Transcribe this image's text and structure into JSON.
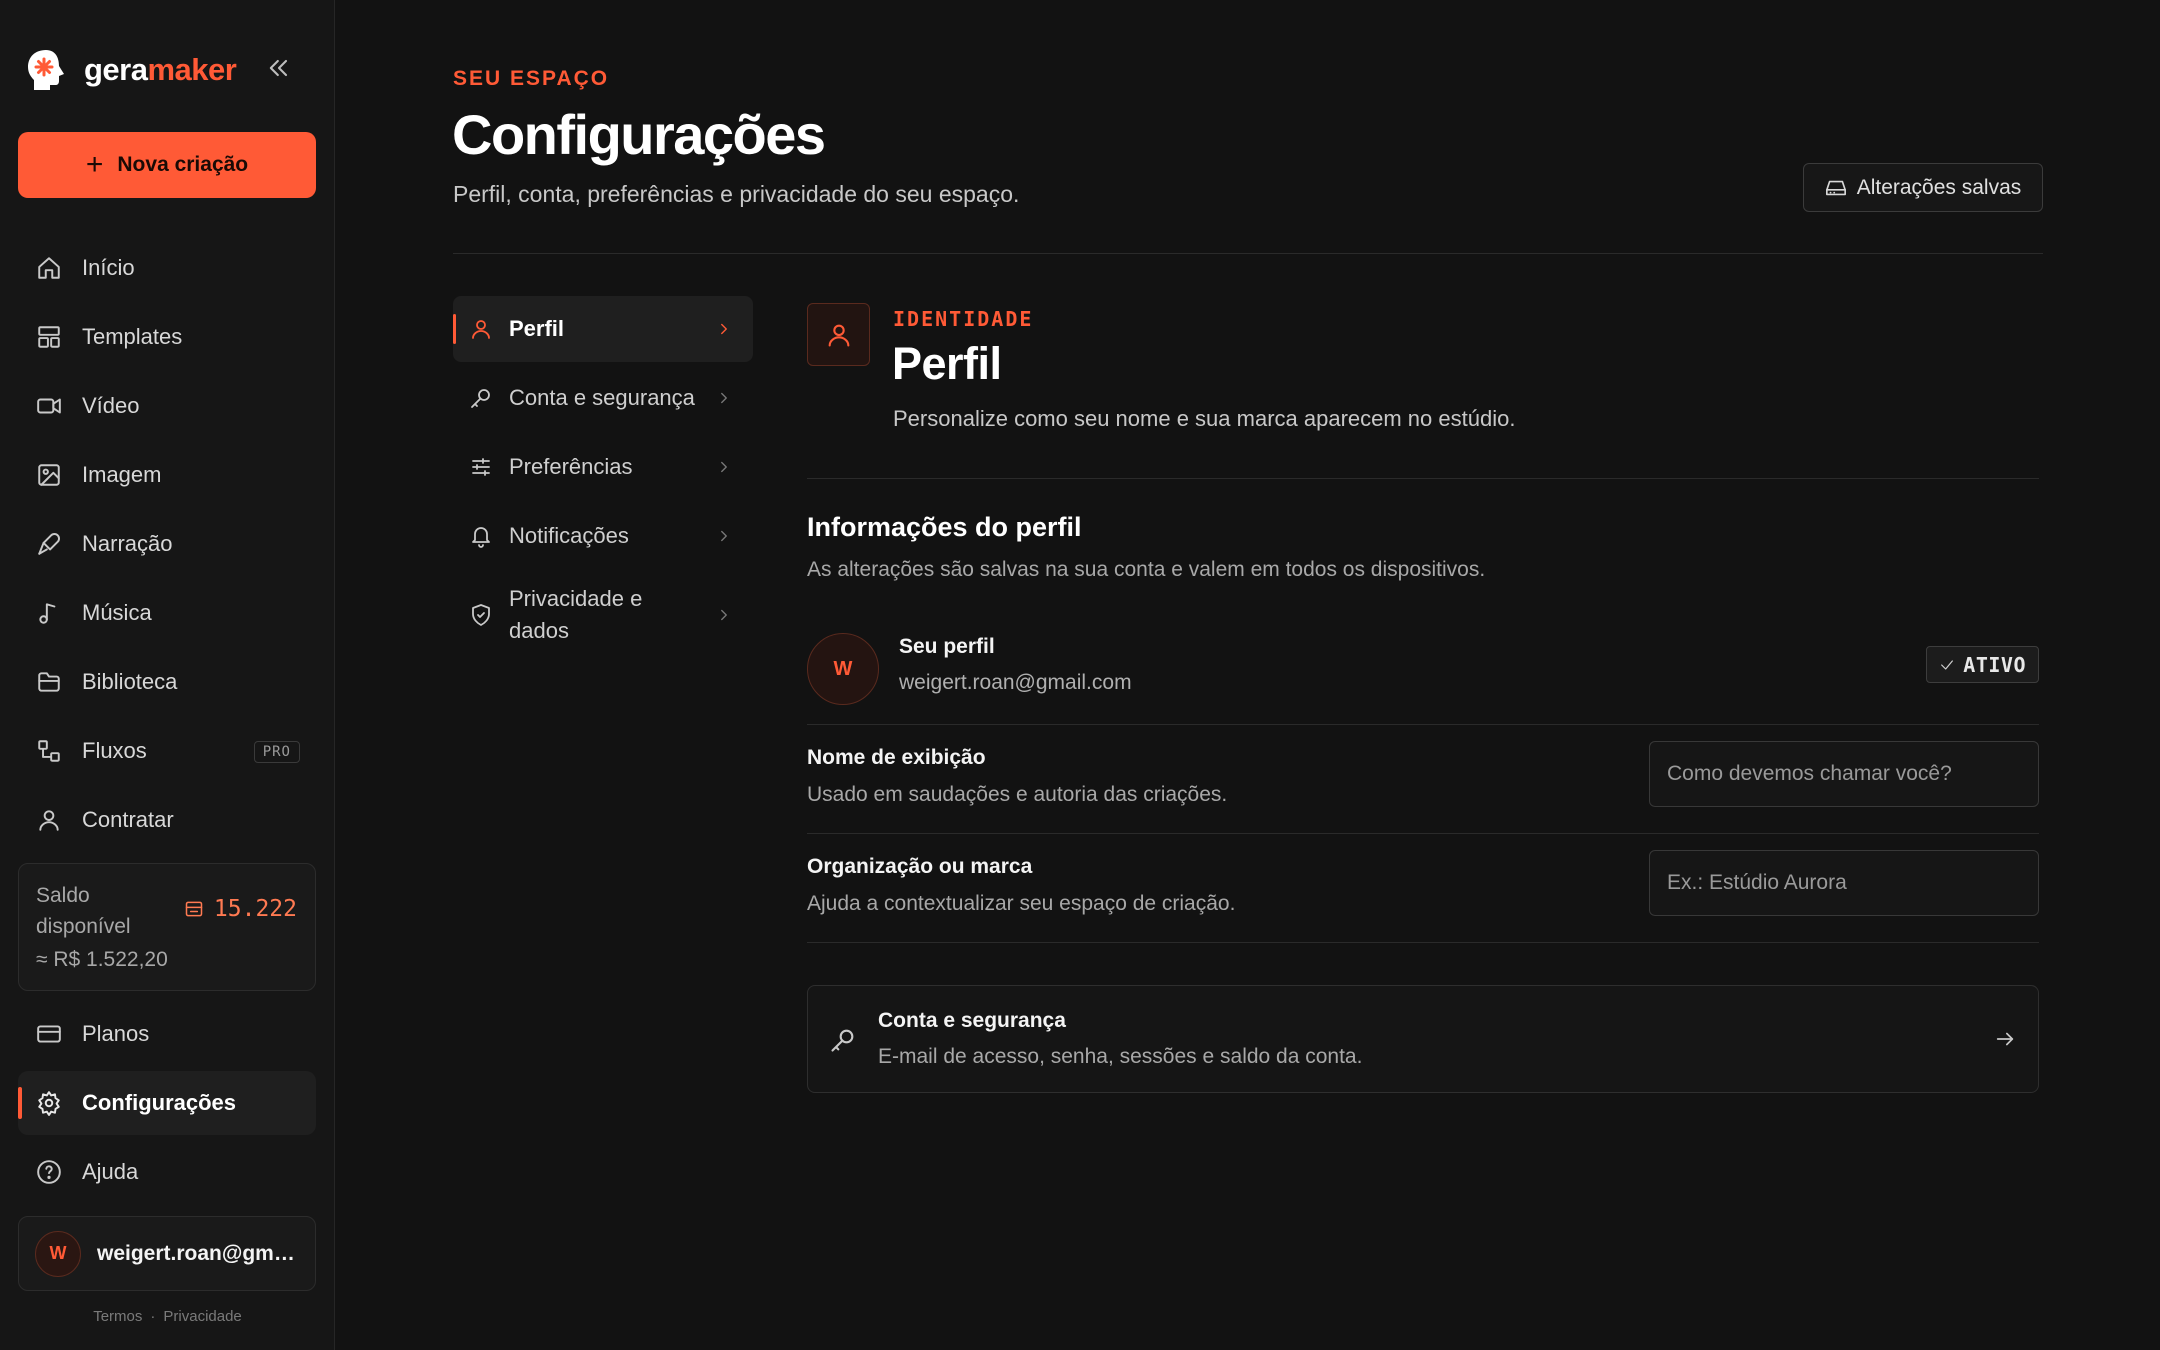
{
  "brand": {
    "name_part1": "gera",
    "name_part2": "maker"
  },
  "sidebar": {
    "new_button": "Nova criação",
    "items": [
      {
        "label": "Início",
        "icon": "home-icon"
      },
      {
        "label": "Templates",
        "icon": "layout-icon"
      },
      {
        "label": "Vídeo",
        "icon": "video-icon"
      },
      {
        "label": "Imagem",
        "icon": "image-icon"
      },
      {
        "label": "Narração",
        "icon": "microphone-icon"
      },
      {
        "label": "Música",
        "icon": "music-note-icon"
      },
      {
        "label": "Biblioteca",
        "icon": "folder-icon"
      },
      {
        "label": "Fluxos",
        "icon": "workflow-icon",
        "badge": "PRO"
      },
      {
        "label": "Contratar",
        "icon": "user-icon"
      }
    ],
    "balance": {
      "label": "Saldo disponível",
      "amount": "15.222",
      "brl": "≈ R$ 1.522,20"
    },
    "bottom_items": [
      {
        "label": "Planos",
        "icon": "credit-card-icon"
      },
      {
        "label": "Configurações",
        "icon": "gear-icon",
        "active": true
      },
      {
        "label": "Ajuda",
        "icon": "help-circle-icon"
      }
    ],
    "user": {
      "initial": "W",
      "email": "weigert.roan@gmail.com"
    },
    "footer": {
      "terms": "Termos",
      "separator": "·",
      "privacy": "Privacidade"
    }
  },
  "header": {
    "eyebrow": "SEU ESPAÇO",
    "title": "Configurações",
    "subtitle": "Perfil, conta, preferências e privacidade do seu espaço.",
    "saved_label": "Alterações salvas"
  },
  "settings_nav": [
    {
      "label": "Perfil",
      "icon": "user-icon",
      "active": true
    },
    {
      "label": "Conta e segurança",
      "icon": "key-icon"
    },
    {
      "label": "Preferências",
      "icon": "sliders-icon"
    },
    {
      "label": "Notificações",
      "icon": "bell-icon"
    },
    {
      "label": "Privacidade e dados",
      "icon": "shield-icon"
    }
  ],
  "identity": {
    "eyebrow": "IDENTIDADE",
    "title": "Perfil",
    "subtitle": "Personalize como seu nome e sua marca aparecem no estúdio."
  },
  "profile_info": {
    "title": "Informações do perfil",
    "subtitle": "As alterações são salvas na sua conta e valem em todos os dispositivos.",
    "card": {
      "initial": "W",
      "name": "Seu perfil",
      "email": "weigert.roan@gmail.com",
      "status": "ATIVO"
    }
  },
  "fields": {
    "display_name": {
      "title": "Nome de exibição",
      "subtitle": "Usado em saudações e autoria das criações.",
      "value": "",
      "placeholder": "Como devemos chamar você?"
    },
    "organization": {
      "title": "Organização ou marca",
      "subtitle": "Ajuda a contextualizar seu espaço de criação.",
      "value": "",
      "placeholder": "Ex.: Estúdio Aurora"
    }
  },
  "security_link": {
    "title": "Conta e segurança",
    "subtitle": "E-mail de acesso, senha, sessões e saldo da conta."
  },
  "colors": {
    "accent": "#ff5a36",
    "background": "#121212",
    "sidebar": "#161616"
  }
}
